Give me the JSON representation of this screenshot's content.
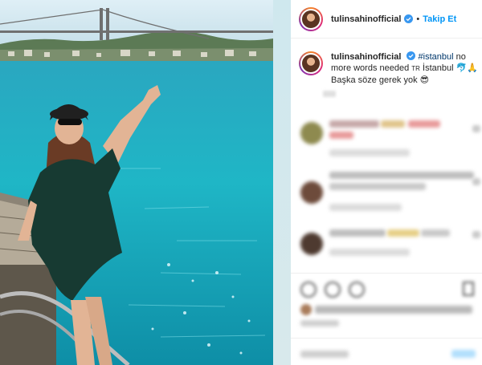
{
  "header": {
    "username": "tulinsahinofficial",
    "separator": "•",
    "follow_label": "Takip Et"
  },
  "caption": {
    "username": "tulinsahinofficial",
    "hashtag": "#istanbul",
    "text_line1": " no more words needed ",
    "flag_text": "TR",
    "text_line2": " İstanbul 🐬🙏 Başka söze gerek yok ",
    "emoji": "😎"
  },
  "comments_blurred": true,
  "colors": {
    "accent": "#0095f6",
    "verified": "#3897f0",
    "sea": "#1fb3c4"
  },
  "icons": [
    "verified-badge-icon",
    "heart-icon",
    "comment-icon",
    "share-icon",
    "bookmark-icon"
  ]
}
